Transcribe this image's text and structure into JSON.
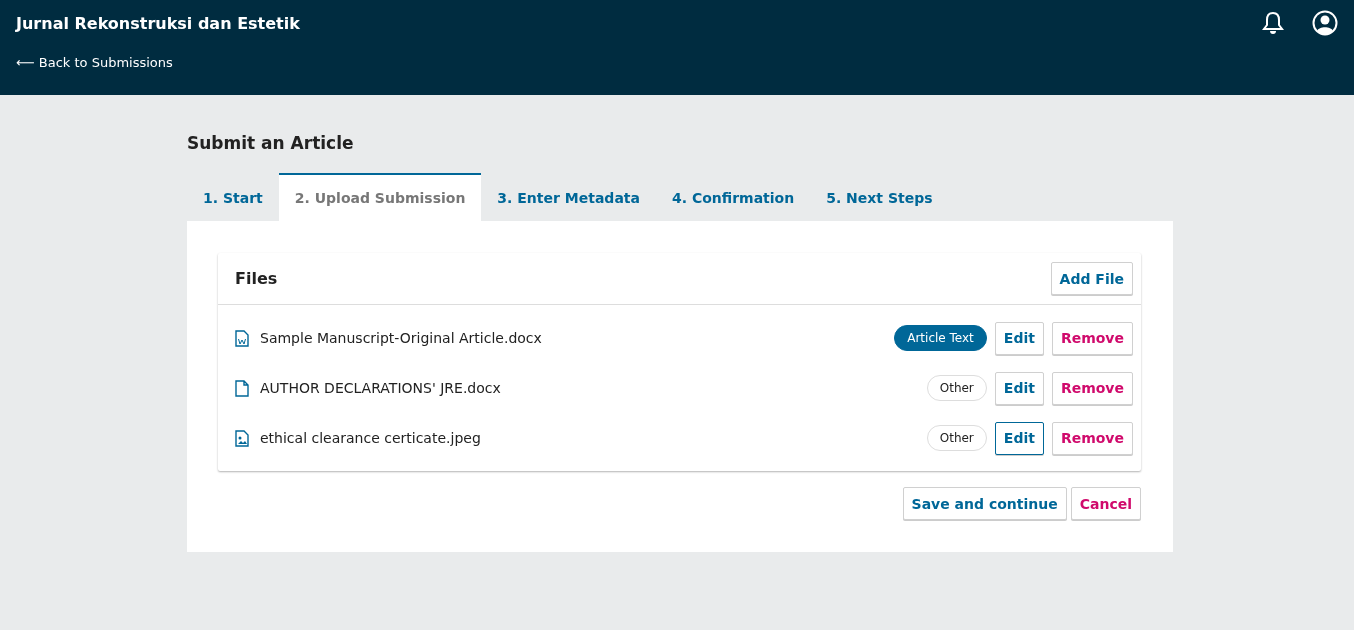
{
  "header": {
    "title": "Jurnal Rekonstruksi dan Estetik",
    "back_link": "⟵ Back to Submissions"
  },
  "page_title": "Submit an Article",
  "tabs": [
    {
      "label": "1. Start",
      "selected": false
    },
    {
      "label": "2. Upload Submission",
      "selected": true
    },
    {
      "label": "3. Enter Metadata",
      "selected": false
    },
    {
      "label": "4. Confirmation",
      "selected": false
    },
    {
      "label": "5. Next Steps",
      "selected": false
    }
  ],
  "files_panel": {
    "title": "Files",
    "add_button": "Add File",
    "files": [
      {
        "kind": "word",
        "name": "Sample Manuscript-Original Article.docx",
        "genre": "Article Text",
        "genre_primary": true,
        "edit": "Edit",
        "edit_focused": false,
        "remove": "Remove"
      },
      {
        "kind": "document",
        "name": "AUTHOR DECLARATIONS' JRE.docx",
        "genre": "Other",
        "genre_primary": false,
        "edit": "Edit",
        "edit_focused": false,
        "remove": "Remove"
      },
      {
        "kind": "image",
        "name": "ethical clearance certicate.jpeg",
        "genre": "Other",
        "genre_primary": false,
        "edit": "Edit",
        "edit_focused": true,
        "remove": "Remove"
      }
    ]
  },
  "actions": {
    "save": "Save and continue",
    "cancel": "Cancel"
  }
}
